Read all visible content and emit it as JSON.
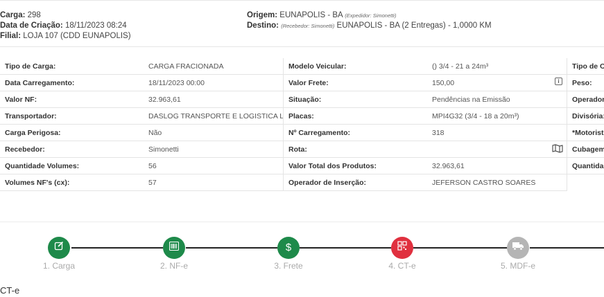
{
  "header": {
    "carga_label": "Carga:",
    "carga_value": "298",
    "criacao_label": "Data de Criação:",
    "criacao_value": "18/11/2023 08:24",
    "filial_label": "Filial:",
    "filial_value": "LOJA 107 (CDD EUNAPOLIS)",
    "origem_label": "Origem:",
    "origem_value": "EUNAPOLIS - BA",
    "origem_note": "(Expedidor: Simonetti)",
    "destino_label": "Destino:",
    "destino_note": "(Recebedor: Simonetti)",
    "destino_value": "EUNAPOLIS - BA (2 Entregas) - 1,0000 KM"
  },
  "col1": [
    {
      "label": "Tipo de Carga:",
      "value": "CARGA FRACIONADA"
    },
    {
      "label": "Data Carregamento:",
      "value": "18/11/2023 00:00"
    },
    {
      "label": "Valor NF:",
      "value": "32.963,61"
    },
    {
      "label": "Transportador:",
      "value": "DASLOG TRANSPORTE E LOGISTICA L..."
    },
    {
      "label": "Carga Perigosa:",
      "value": "Não"
    },
    {
      "label": "Recebedor:",
      "value": "Simonetti"
    },
    {
      "label": "Quantidade Volumes:",
      "value": "56"
    },
    {
      "label": "Volumes NF's (cx):",
      "value": "57"
    }
  ],
  "col2": [
    {
      "label": "Modelo Veicular:",
      "value": "() 3/4 - 21 a 24m³"
    },
    {
      "label": "Valor Frete:",
      "value": "150,00"
    },
    {
      "label": "Situação:",
      "value": "Pendências na Emissão"
    },
    {
      "label": "Placas:",
      "value": "MPI4G32 (3/4 - 18 a 20m³)"
    },
    {
      "label": "Nº Carregamento:",
      "value": "318"
    },
    {
      "label": "Rota:",
      "value": ""
    },
    {
      "label": "Valor Total dos Produtos:",
      "value": "32.963,61"
    },
    {
      "label": "Operador de Inserção:",
      "value": "JEFERSON CASTRO SOARES"
    }
  ],
  "col3": [
    {
      "label": "Tipo de Op"
    },
    {
      "label": "Peso:"
    },
    {
      "label": "Operador:"
    },
    {
      "label": "Divisória:"
    },
    {
      "label": "*Motorist"
    },
    {
      "label": "Cubagem"
    },
    {
      "label": "Quantidad"
    }
  ],
  "icons": {
    "frete_info": "info-icon",
    "rota_map": "map-icon"
  },
  "steps": [
    {
      "label": "1. Carga",
      "icon": "edit-icon",
      "color": "#1e8a4a"
    },
    {
      "label": "2. NF-e",
      "icon": "barcode-icon",
      "color": "#1e8a4a"
    },
    {
      "label": "3. Frete",
      "icon": "dollar-icon",
      "color": "#1e8a4a"
    },
    {
      "label": "4. CT-e",
      "icon": "qrcode-icon",
      "color": "#e0303f"
    },
    {
      "label": "5. MDF-e",
      "icon": "truck-icon",
      "color": "#b5b5b5"
    }
  ],
  "section_title": "CT-e"
}
